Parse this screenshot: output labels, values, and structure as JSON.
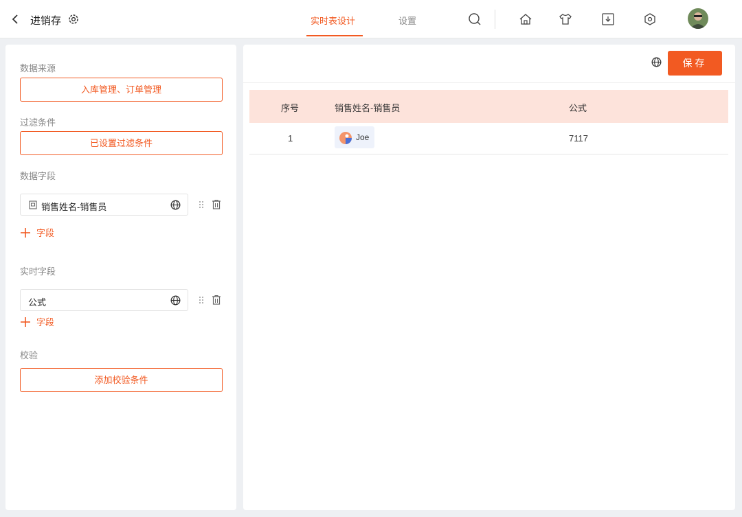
{
  "header": {
    "title": "进销存",
    "tabs": [
      {
        "label": "实时表设计",
        "active": true
      },
      {
        "label": "设置",
        "active": false
      }
    ]
  },
  "left": {
    "data_source": {
      "label": "数据来源",
      "value": "入库管理、订单管理"
    },
    "filter": {
      "label": "过滤条件",
      "value": "已设置过滤条件"
    },
    "data_fields": {
      "label": "数据字段",
      "items": [
        "销售姓名-销售员"
      ],
      "add_label": "字段"
    },
    "realtime_fields": {
      "label": "实时字段",
      "items": [
        "公式"
      ],
      "add_label": "字段"
    },
    "validation": {
      "label": "校验",
      "button": "添加校验条件"
    }
  },
  "right": {
    "save_label": "保存",
    "table": {
      "columns": [
        "序号",
        "销售姓名-销售员",
        "公式"
      ],
      "rows": [
        {
          "index": "1",
          "user": "Joe",
          "formula": "7117"
        }
      ]
    }
  },
  "colors": {
    "accent": "#f25a22",
    "header_bg": "#fde3db",
    "page_bg": "#eef0f3"
  }
}
